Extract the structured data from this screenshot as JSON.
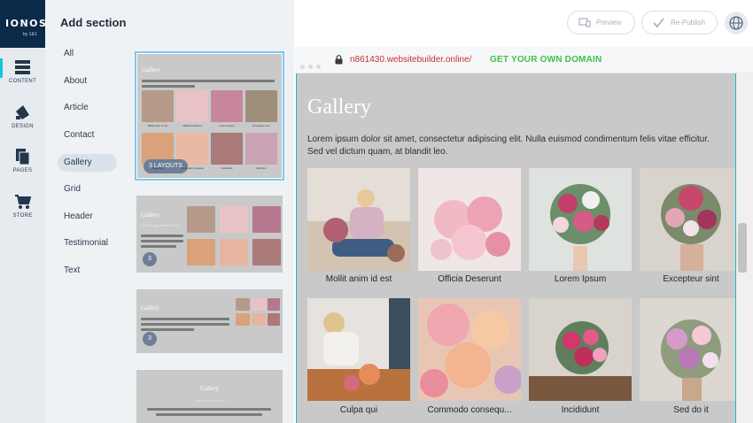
{
  "brand": {
    "logo": "IONOS",
    "by": "by 1&1"
  },
  "rail": [
    {
      "label": "CONTENT",
      "icon": "content-icon"
    },
    {
      "label": "DESIGN",
      "icon": "design-icon"
    },
    {
      "label": "PAGES",
      "icon": "pages-icon"
    },
    {
      "label": "STORE",
      "icon": "store-icon"
    }
  ],
  "panel": {
    "title": "Add section",
    "categories": [
      "All",
      "About",
      "Article",
      "Contact",
      "Gallery",
      "Grid",
      "Header",
      "Testimonial",
      "Text"
    ],
    "active_category": "Gallery",
    "thumbs": [
      {
        "badge": "3 LAYOUTS",
        "title": "Gallery"
      },
      {
        "badge": "3",
        "title": "Gallery",
        "subtitle": "Nullam eget molestie risus"
      },
      {
        "badge": "3",
        "title": "Gallery"
      },
      {
        "title": "Gallery",
        "subtitle": "Lorem mattis ultrices"
      }
    ]
  },
  "toolbar": {
    "preview": "Preview",
    "republish": "Re-Publish"
  },
  "browser": {
    "url": "n861430.websitebuilder.online/",
    "cta": "GET YOUR OWN DOMAIN"
  },
  "gallery": {
    "title": "Gallery",
    "lead_1": "Lorem ipsum dolor sit amet, consectetur adipiscing elit. Nulla euismod condimentum felis vitae efficitur.",
    "lead_2": "Sed vel dictum quam, at blandit leo.",
    "items": [
      "Mollit anim id est",
      "Officia Deserunt",
      "Lorem Ipsum",
      "Excepteur sint",
      "Culpa qui",
      "Commodo consequ...",
      "Incididunt",
      "Sed do it"
    ],
    "thumb_captions": [
      "Mollit anim id est",
      "Officia Deserunt",
      "Lorem Ipsum",
      "Excepteur sint",
      "Culpa qui",
      "Commodo consequ",
      "Incididunt",
      "Sed do it"
    ]
  },
  "colors": {
    "accent": "#13b7d9",
    "navy": "#0b2a4a",
    "url": "#c9302c",
    "cta": "#3fc04d"
  }
}
